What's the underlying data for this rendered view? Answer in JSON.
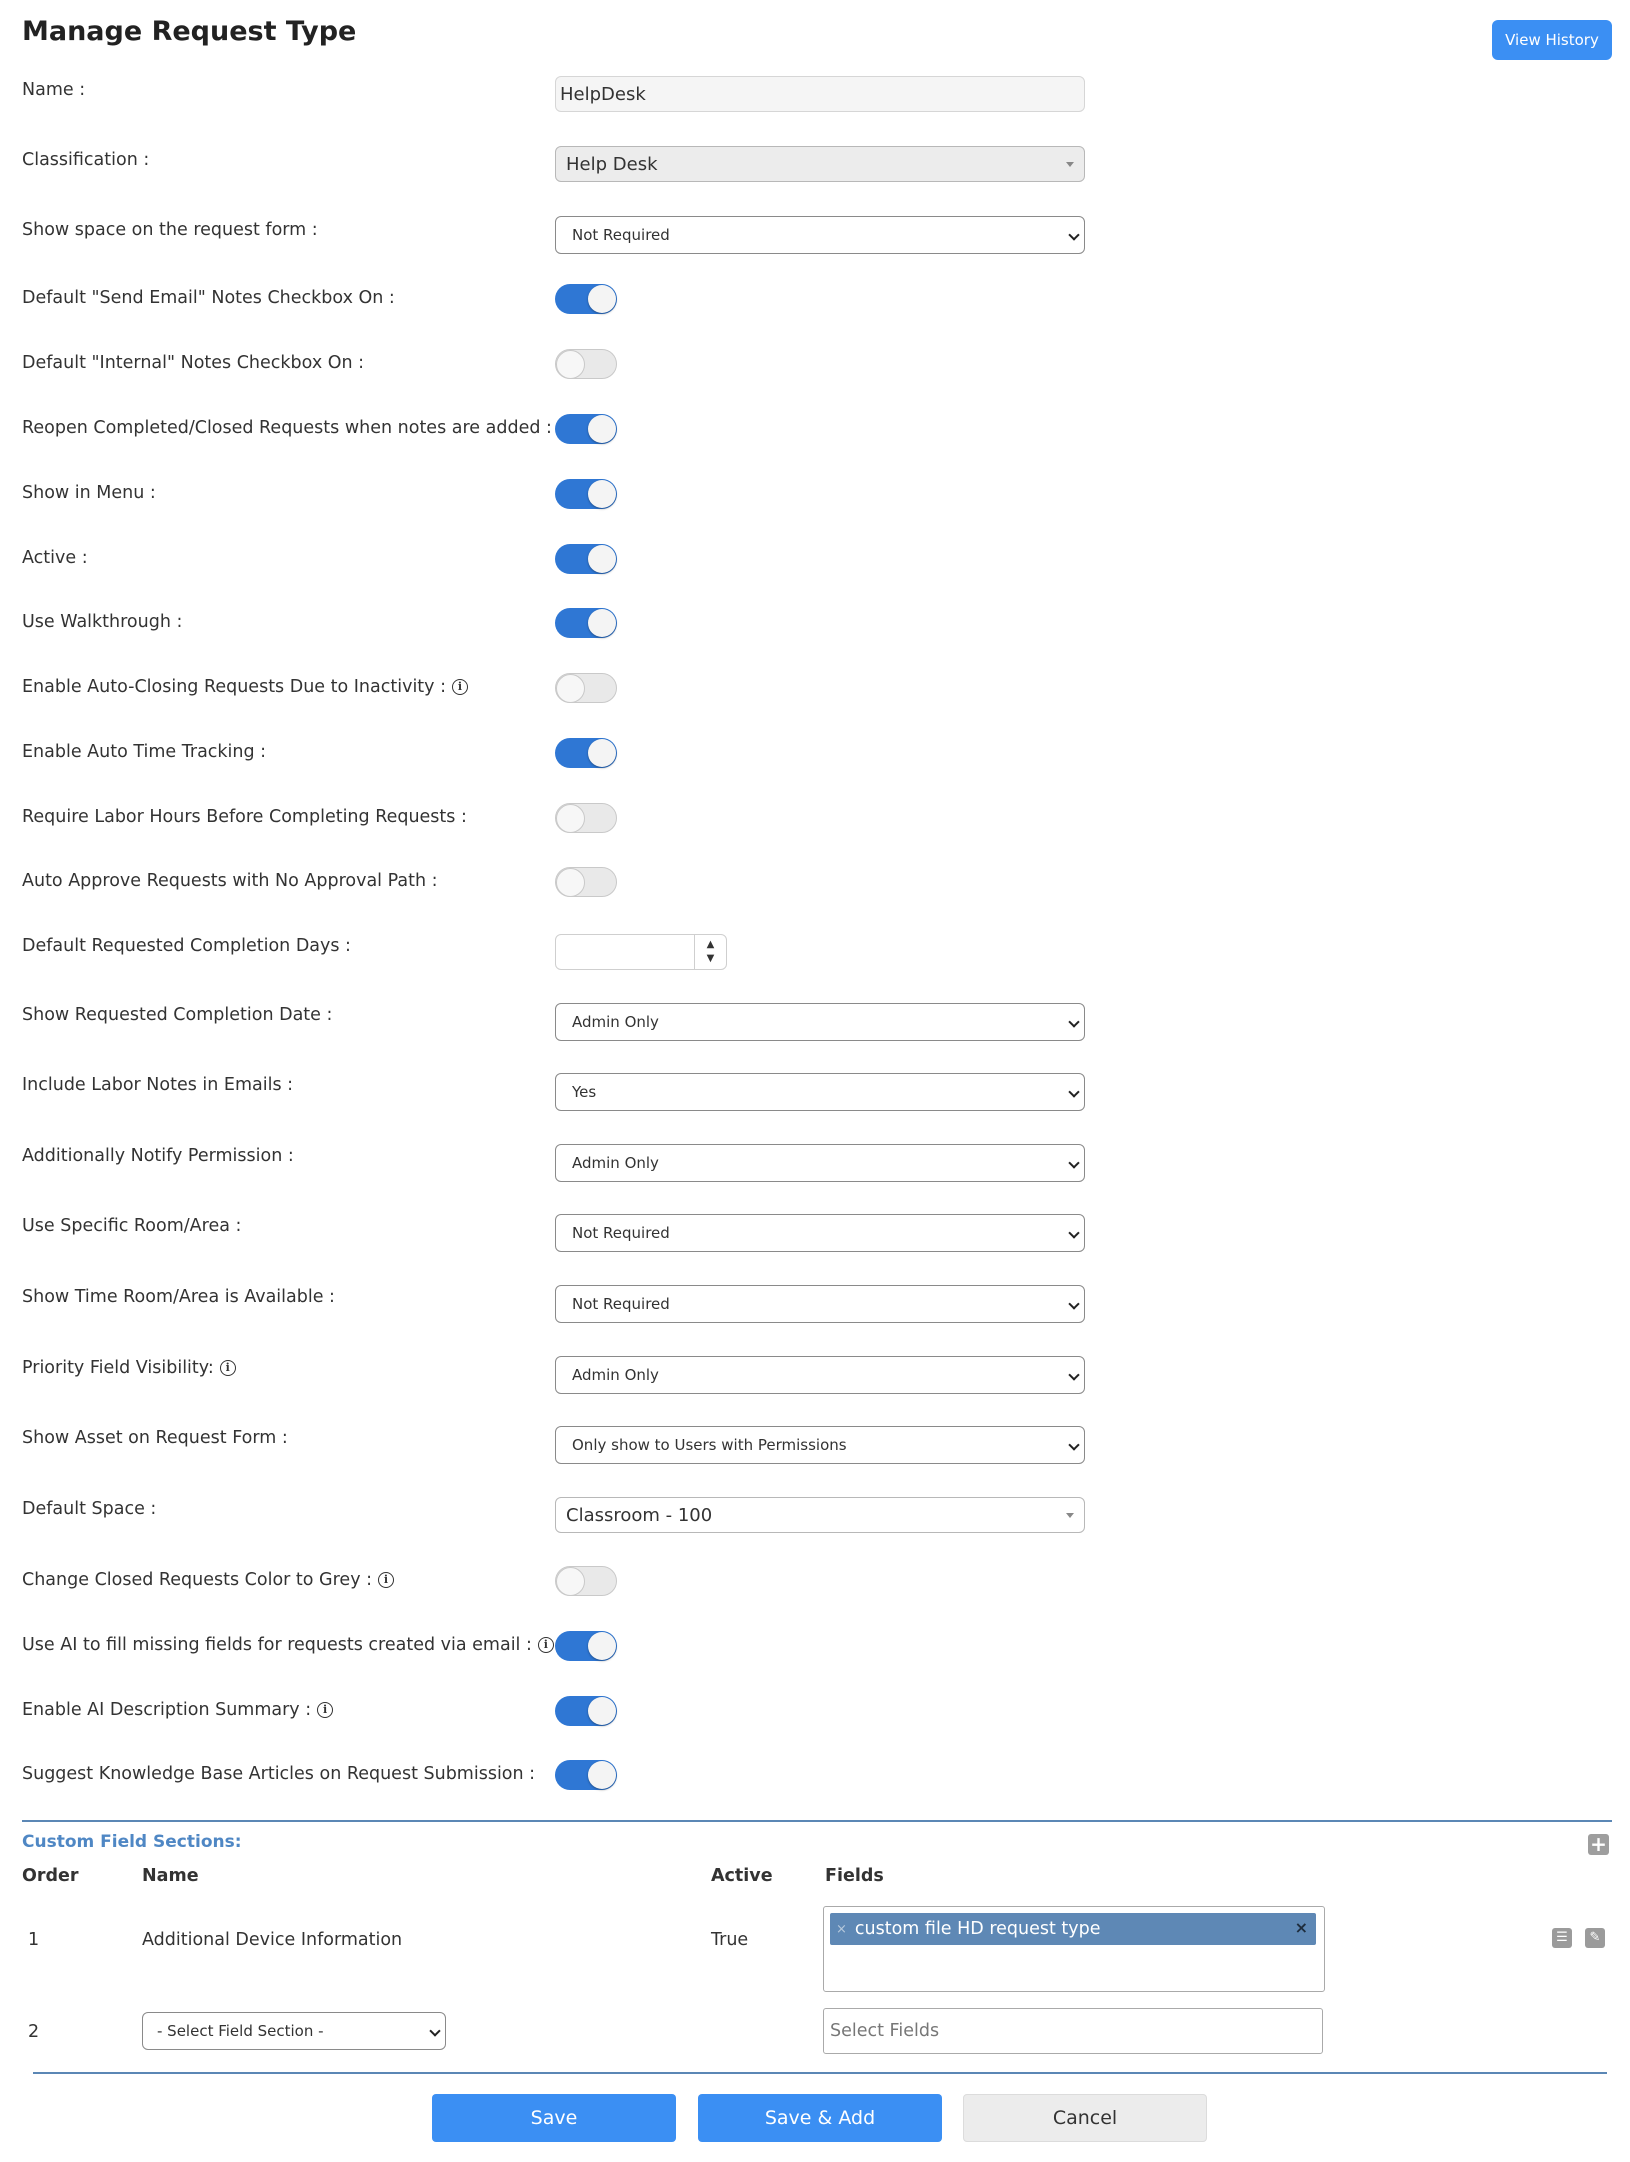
{
  "page": {
    "title": "Manage Request Type",
    "view_history_label": "View History"
  },
  "form": {
    "name_label": "Name :",
    "name_value": "HelpDesk",
    "classification_label": "Classification :",
    "classification_value": "Help Desk",
    "show_space_label": "Show space on the request form :",
    "show_space_value": "Not Required",
    "send_email_label": "Default \"Send Email\" Notes Checkbox On :",
    "send_email_on": true,
    "internal_label": "Default \"Internal\" Notes Checkbox On :",
    "internal_on": false,
    "reopen_label": "Reopen Completed/Closed Requests when notes are added :",
    "reopen_on": true,
    "show_in_menu_label": "Show in Menu :",
    "show_in_menu_on": true,
    "active_label": "Active :",
    "active_on": true,
    "walkthrough_label": "Use Walkthrough :",
    "walkthrough_on": true,
    "auto_closing_label": "Enable Auto-Closing Requests Due to Inactivity :",
    "auto_closing_on": false,
    "auto_time_label": "Enable Auto Time Tracking :",
    "auto_time_on": true,
    "labor_hours_label": "Require Labor Hours Before Completing Requests :",
    "labor_hours_on": false,
    "auto_approve_label": "Auto Approve Requests with No Approval Path :",
    "auto_approve_on": false,
    "completion_days_label": "Default Requested Completion Days :",
    "completion_days_value": "",
    "show_completion_date_label": "Show Requested Completion Date :",
    "show_completion_date_value": "Admin Only",
    "labor_notes_label": "Include Labor Notes in Emails :",
    "labor_notes_value": "Yes",
    "notify_permission_label": "Additionally Notify Permission :",
    "notify_permission_value": "Admin Only",
    "specific_room_label": "Use Specific Room/Area :",
    "specific_room_value": "Not Required",
    "time_room_label": "Show Time Room/Area is Available :",
    "time_room_value": "Not Required",
    "priority_label": "Priority Field Visibility:",
    "priority_value": "Admin Only",
    "show_asset_label": "Show Asset on Request Form :",
    "show_asset_value": "Only show to Users with Permissions",
    "default_space_label": "Default Space :",
    "default_space_value": "Classroom - 100",
    "grey_closed_label": "Change Closed Requests Color to Grey :",
    "grey_closed_on": false,
    "ai_fill_label": "Use AI to fill missing fields for requests created via email :",
    "ai_fill_on": true,
    "ai_summary_label": "Enable AI Description Summary :",
    "ai_summary_on": true,
    "kb_suggest_label": "Suggest Knowledge Base Articles on Request Submission :",
    "kb_suggest_on": true
  },
  "custom_sections": {
    "title": "Custom Field Sections:",
    "headers": {
      "order": "Order",
      "name": "Name",
      "active": "Active",
      "fields": "Fields"
    },
    "rows": [
      {
        "order": "1",
        "name": "Additional Device Information",
        "active": "True",
        "field_chip": "custom file HD request type"
      },
      {
        "order": "2",
        "section_select": "- Select Field Section -",
        "fields_placeholder": "Select Fields"
      }
    ]
  },
  "actions": {
    "save": "Save",
    "save_add": "Save & Add",
    "cancel": "Cancel"
  },
  "colors": {
    "accent": "#3b8ff3",
    "toggle_on": "#2f77d4",
    "section_title": "#4f87c4",
    "chip": "#5e88b5"
  }
}
